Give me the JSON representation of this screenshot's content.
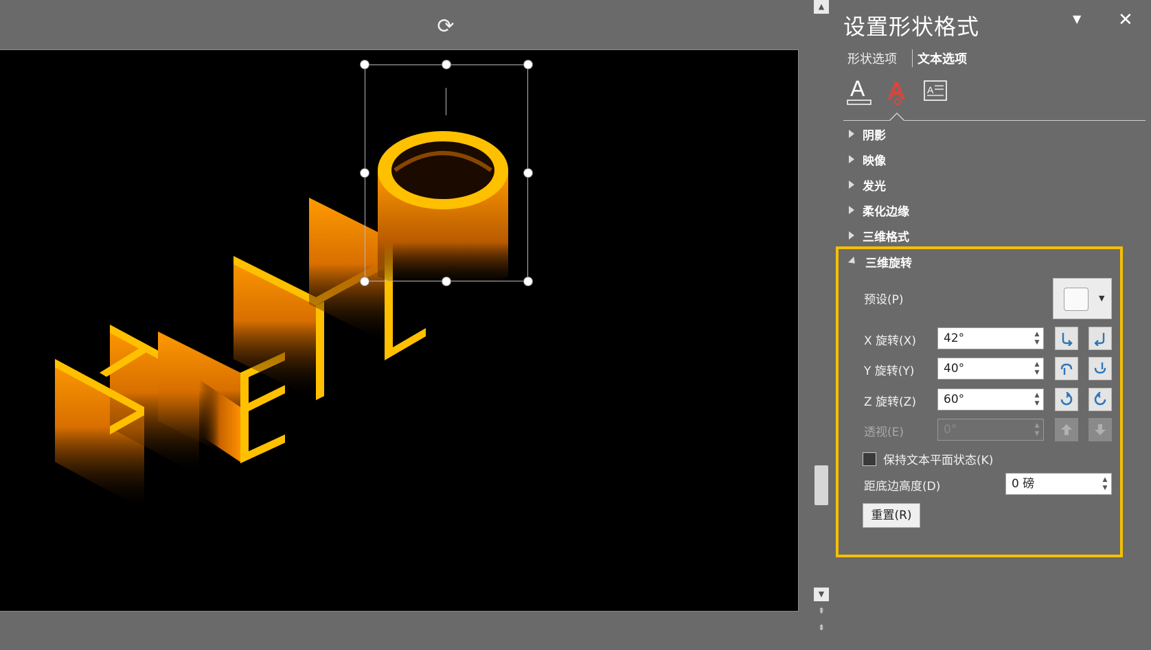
{
  "pane": {
    "title": "设置形状格式",
    "tabs": {
      "shape": "形状选项",
      "text": "文本选项"
    },
    "icons": [
      "text-fill-outline-icon",
      "text-effects-icon",
      "textbox-layout-icon"
    ],
    "sections": {
      "shadow": "阴影",
      "reflection": "映像",
      "glow": "发光",
      "soft_edges": "柔化边缘",
      "format_3d": "三维格式",
      "rotation_3d": "三维旋转"
    },
    "rotation": {
      "preset_label": "预设(P)",
      "x_label": "X 旋转(X)",
      "x_value": "42°",
      "y_label": "Y 旋转(Y)",
      "y_value": "40°",
      "z_label": "Z 旋转(Z)",
      "z_value": "60°",
      "perspective_label": "透视(E)",
      "perspective_value": "0°",
      "keep_flat_label": "保持文本平面状态(K)",
      "keep_flat_checked": false,
      "distance_label": "距底边高度(D)",
      "distance_value": "0 磅",
      "reset_label": "重置(R)"
    }
  },
  "slide": {
    "letters": [
      "H",
      "E",
      "L",
      "L",
      "O"
    ]
  },
  "colors": {
    "highlight": "#f5c000",
    "text_gold": "#ffc000",
    "extrude_orange": "#e87a00",
    "pane_bg": "#6a6a6a",
    "slide_bg": "#000000"
  }
}
